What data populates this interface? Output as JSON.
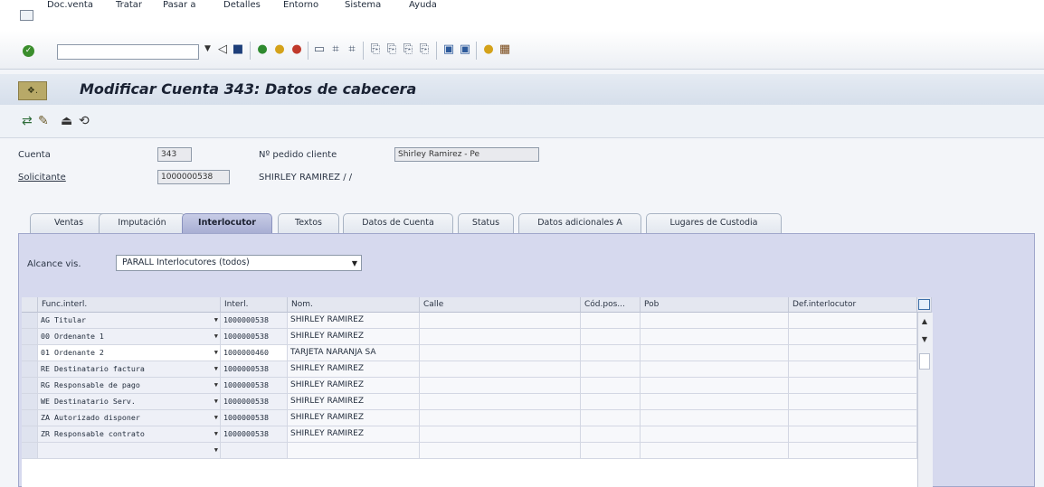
{
  "menu": [
    "Doc.venta",
    "Tratar",
    "Pasar a",
    "Detalles",
    "Entorno",
    "Sistema",
    "Ayuda"
  ],
  "title": "Modificar Cuenta 343: Datos de cabecera",
  "header": {
    "cuenta_label": "Cuenta",
    "cuenta_value": "343",
    "pedido_label": "Nº pedido cliente",
    "pedido_value": "Shirley Ramirez - Pe",
    "solicitante_label": "Solicitante",
    "solicitante_value": "1000000538",
    "solicitante_name": "SHIRLEY RAMIREZ / /"
  },
  "tabs": [
    "Ventas",
    "Imputación",
    "Interlocutor",
    "Textos",
    "Datos de Cuenta",
    "Status",
    "Datos adicionales A",
    "Lugares de Custodia"
  ],
  "active_tab": "Interlocutor",
  "alcance": {
    "label": "Alcance vis.",
    "value": "PARALL Interlocutores (todos)"
  },
  "table": {
    "columns": [
      "Func.interl.",
      "Interl.",
      "Nom.",
      "Calle",
      "Cód.pos...",
      "Pob",
      "Def.interlocutor"
    ],
    "rows": [
      {
        "func": "AG Titular",
        "interl": "1000000538",
        "nom": "SHIRLEY RAMIREZ"
      },
      {
        "func": "00 Ordenante 1",
        "interl": "1000000538",
        "nom": "SHIRLEY RAMIREZ"
      },
      {
        "func": "01 Ordenante 2",
        "interl": "1000000460",
        "nom": "TARJETA NARANJA SA"
      },
      {
        "func": "RE Destinatario factura",
        "interl": "1000000538",
        "nom": "SHIRLEY RAMIREZ"
      },
      {
        "func": "RG Responsable de pago",
        "interl": "1000000538",
        "nom": "SHIRLEY RAMIREZ"
      },
      {
        "func": "WE Destinatario Serv.",
        "interl": "1000000538",
        "nom": "SHIRLEY RAMIREZ"
      },
      {
        "func": "ZA Autorizado disponer",
        "interl": "1000000538",
        "nom": "SHIRLEY RAMIREZ"
      },
      {
        "func": "ZR Responsable contrato",
        "interl": "1000000538",
        "nom": "SHIRLEY RAMIREZ"
      },
      {
        "func": "",
        "interl": "",
        "nom": ""
      }
    ]
  },
  "colors": {
    "accent": "#a8aed3",
    "ok_icon": "#3b8e2d"
  }
}
